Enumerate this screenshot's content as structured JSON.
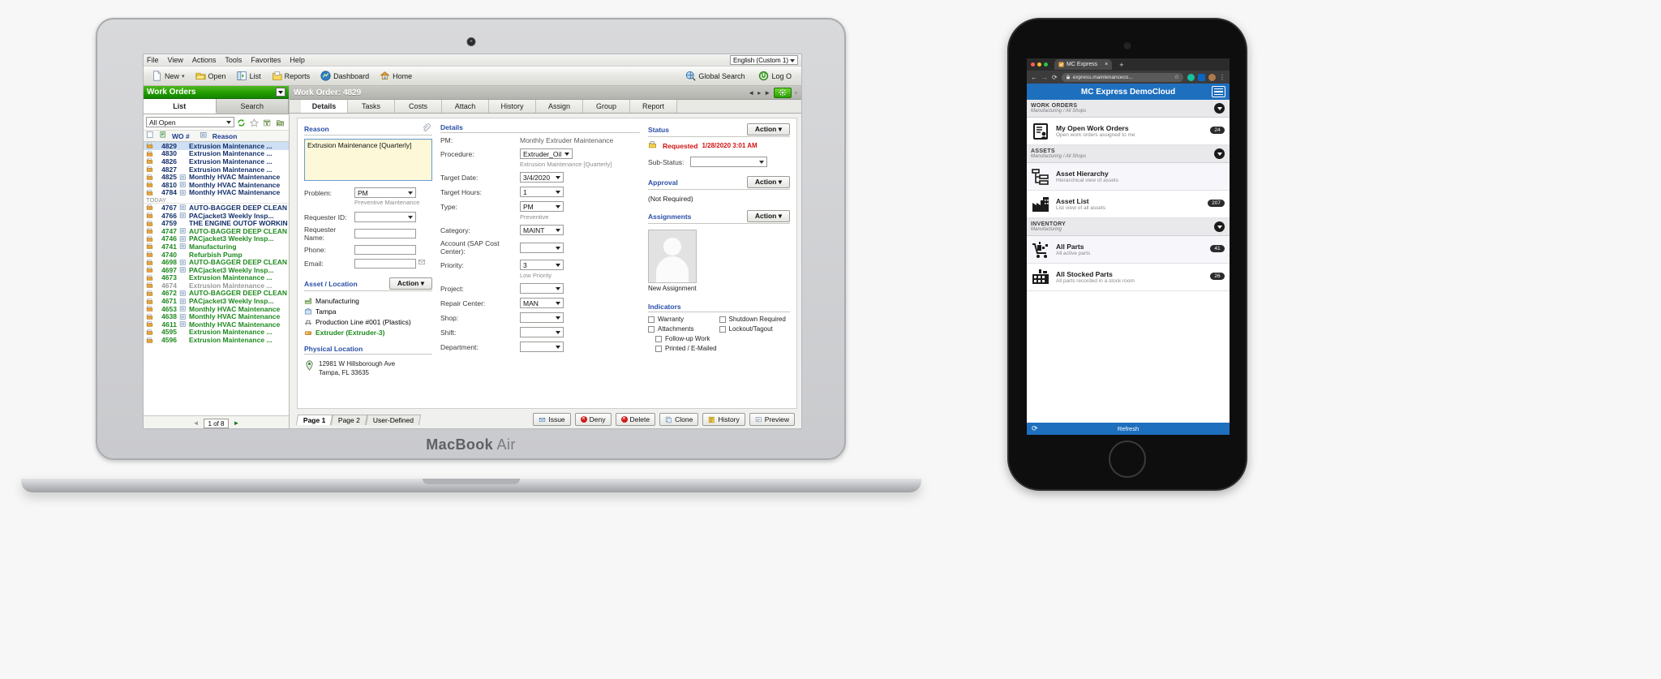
{
  "laptop": {
    "brand_line": "MacBook Air",
    "brand_bold": "MacBook",
    "brand_rest": " Air"
  },
  "app": {
    "menubar": [
      "File",
      "View",
      "Actions",
      "Tools",
      "Favorites",
      "Help"
    ],
    "language": "English (Custom 1)",
    "toolbar": [
      {
        "label": "New",
        "icon": "page-icon",
        "caret": true
      },
      {
        "label": "Open",
        "icon": "open-folder-icon"
      },
      {
        "label": "List",
        "icon": "list-icon"
      },
      {
        "label": "Reports",
        "icon": "reports-icon"
      },
      {
        "label": "Dashboard",
        "icon": "dashboard-icon"
      },
      {
        "label": "Home",
        "icon": "home-icon"
      }
    ],
    "toolbar_right": [
      {
        "label": "Global Search",
        "icon": "globe-search-icon"
      },
      {
        "label": "Log O",
        "icon": "logout-icon"
      }
    ]
  },
  "left": {
    "module_title": "Work Orders",
    "tabs": [
      {
        "label": "List",
        "active": true
      },
      {
        "label": "Search",
        "active": false
      }
    ],
    "filter": "All Open",
    "columns": [
      "WO #",
      "Reason"
    ],
    "today_label": "TODAY",
    "rows": [
      {
        "wo": "4829",
        "reason": "Extrusion Maintenance ...",
        "color": "dark",
        "selected": true,
        "pm": false
      },
      {
        "wo": "4830",
        "reason": "Extrusion Maintenance ...",
        "color": "dark",
        "selected": false,
        "pm": false
      },
      {
        "wo": "4826",
        "reason": "Extrusion Maintenance ...",
        "color": "dark",
        "selected": false,
        "pm": false
      },
      {
        "wo": "4827",
        "reason": "Extrusion Maintenance ...",
        "color": "dark",
        "selected": false,
        "pm": false
      },
      {
        "wo": "4825",
        "reason": "Monthly HVAC Maintenance",
        "color": "dark",
        "selected": false,
        "pm": true
      },
      {
        "wo": "4810",
        "reason": "Monthly HVAC Maintenance",
        "color": "dark",
        "selected": false,
        "pm": true
      },
      {
        "wo": "4784",
        "reason": "Monthly HVAC Maintenance",
        "color": "dark",
        "selected": false,
        "pm": true
      },
      {
        "wo": "4767",
        "reason": "AUTO-BAGGER DEEP CLEAN",
        "color": "dark",
        "selected": false,
        "pm": true
      },
      {
        "wo": "4766",
        "reason": "PACjacket3 Weekly Insp...",
        "color": "dark",
        "selected": false,
        "pm": true
      },
      {
        "wo": "4759",
        "reason": "THE ENGINE OUTOF WORKIN",
        "color": "dark",
        "selected": false,
        "pm": false
      },
      {
        "wo": "4747",
        "reason": "AUTO-BAGGER DEEP CLEAN",
        "color": "green",
        "selected": false,
        "pm": true
      },
      {
        "wo": "4746",
        "reason": "PACjacket3 Weekly Insp...",
        "color": "green",
        "selected": false,
        "pm": true
      },
      {
        "wo": "4741",
        "reason": "Manufacturing",
        "color": "green",
        "selected": false,
        "pm": true
      },
      {
        "wo": "4740",
        "reason": "Refurbish Pump",
        "color": "green",
        "selected": false,
        "pm": false
      },
      {
        "wo": "4698",
        "reason": "AUTO-BAGGER DEEP CLEAN",
        "color": "green",
        "selected": false,
        "pm": true
      },
      {
        "wo": "4697",
        "reason": "PACjacket3 Weekly Insp...",
        "color": "green",
        "selected": false,
        "pm": true
      },
      {
        "wo": "4673",
        "reason": "Extrusion Maintenance ...",
        "color": "green",
        "selected": false,
        "pm": false
      },
      {
        "wo": "4674",
        "reason": "Extrusion Maintenance ...",
        "color": "gray",
        "selected": false,
        "pm": false
      },
      {
        "wo": "4672",
        "reason": "AUTO-BAGGER DEEP CLEAN",
        "color": "green",
        "selected": false,
        "pm": true
      },
      {
        "wo": "4671",
        "reason": "PACjacket3 Weekly Insp...",
        "color": "green",
        "selected": false,
        "pm": true
      },
      {
        "wo": "4653",
        "reason": "Monthly HVAC Maintenance",
        "color": "green",
        "selected": false,
        "pm": true
      },
      {
        "wo": "4638",
        "reason": "Monthly HVAC Maintenance",
        "color": "green",
        "selected": false,
        "pm": true
      },
      {
        "wo": "4611",
        "reason": "Monthly HVAC Maintenance",
        "color": "green",
        "selected": false,
        "pm": true
      },
      {
        "wo": "4595",
        "reason": "Extrusion Maintenance ...",
        "color": "green",
        "selected": false,
        "pm": false
      },
      {
        "wo": "4596",
        "reason": "Extrusion Maintenance ...",
        "color": "green",
        "selected": false,
        "pm": false
      }
    ],
    "pager": {
      "text": "1 of 8",
      "prev": "◄",
      "next": "►"
    }
  },
  "record": {
    "title": "Work Order: 4829",
    "tabs": [
      {
        "label": "Details",
        "active": true
      },
      {
        "label": "Tasks",
        "active": false
      },
      {
        "label": "Costs",
        "active": false
      },
      {
        "label": "Attach",
        "active": false
      },
      {
        "label": "History",
        "active": false
      },
      {
        "label": "Assign",
        "active": false
      },
      {
        "label": "Group",
        "active": false
      },
      {
        "label": "Report",
        "active": false
      }
    ]
  },
  "reason_panel": {
    "label": "Reason",
    "text": "Extrusion Maintenance [Quarterly]",
    "problem_label": "Problem:",
    "problem_value": "PM",
    "problem_hint": "Preventive Maintenance",
    "requester_id_label": "Requester ID:",
    "requester_id_value": "",
    "requester_name_label": "Requester Name:",
    "requester_name_value": "",
    "phone_label": "Phone:",
    "phone_value": "",
    "email_label": "Email:",
    "email_value": ""
  },
  "asset_panel": {
    "label": "Asset / Location",
    "action": "Action",
    "lines": [
      {
        "text": "Manufacturing",
        "icon": "factory-icon",
        "highlight": false
      },
      {
        "text": "Tampa",
        "icon": "site-icon",
        "highlight": false
      },
      {
        "text": "Production Line #001 (Plastics)",
        "icon": "line-icon",
        "highlight": false
      },
      {
        "text": "Extruder (Extruder-3)",
        "icon": "asset-icon",
        "highlight": true
      }
    ],
    "physical_label": "Physical Location",
    "address1": "12981 W Hillsborough Ave",
    "address2": "Tampa, FL 33635"
  },
  "details_panel": {
    "label": "Details",
    "fields": [
      {
        "label": "PM:",
        "type": "text",
        "value": "Monthly Extruder Maintenance"
      },
      {
        "label": "Procedure:",
        "type": "select",
        "value": "Extruder_Oil",
        "hint": "Extrusion Maintenance [Quarterly]"
      },
      {
        "label": "Target Date:",
        "type": "select",
        "value": "3/4/2020"
      },
      {
        "label": "Target Hours:",
        "type": "select",
        "value": "1"
      },
      {
        "label": "Type:",
        "type": "select",
        "value": "PM",
        "hint": "Preventive"
      },
      {
        "label": "Category:",
        "type": "select",
        "value": "MAINT"
      },
      {
        "label": "Account (SAP Cost Center):",
        "type": "select",
        "value": ""
      },
      {
        "label": "Priority:",
        "type": "select",
        "value": "3",
        "hint": "Low Priority"
      },
      {
        "label": "Project:",
        "type": "select",
        "value": ""
      },
      {
        "label": "Repair Center:",
        "type": "select",
        "value": "MAN"
      },
      {
        "label": "Shop:",
        "type": "select",
        "value": ""
      },
      {
        "label": "Shift:",
        "type": "select",
        "value": ""
      },
      {
        "label": "Department:",
        "type": "select",
        "value": ""
      }
    ]
  },
  "status_panel": {
    "label": "Status",
    "action": "Action",
    "state": "Requested",
    "datetime": "1/28/2020 3:01 AM",
    "substatus_label": "Sub-Status:",
    "substatus_value": ""
  },
  "approval_panel": {
    "label": "Approval",
    "action": "Action",
    "value": "(Not Required)"
  },
  "assignments_panel": {
    "label": "Assignments",
    "action": "Action",
    "caption": "New Assignment"
  },
  "indicators_panel": {
    "label": "Indicators",
    "items": [
      {
        "label": "Warranty",
        "checked": false
      },
      {
        "label": "Shutdown Required",
        "checked": false
      },
      {
        "label": "Attachments",
        "checked": false
      },
      {
        "label": "Lockout/Tagout",
        "checked": false
      },
      {
        "label": "Follow-up Work",
        "checked": false
      },
      {
        "label": "Printed / E-Mailed",
        "checked": false
      }
    ]
  },
  "page_tabs": [
    {
      "label": "Page 1",
      "active": true
    },
    {
      "label": "Page 2",
      "active": false
    },
    {
      "label": "User-Defined",
      "active": false
    }
  ],
  "bottom_buttons": [
    {
      "label": "Issue",
      "icon": "issue-icon",
      "style": "plain"
    },
    {
      "label": "Deny",
      "icon": "deny-icon",
      "style": "red"
    },
    {
      "label": "Delete",
      "icon": "delete-icon",
      "style": "red"
    },
    {
      "label": "Clone",
      "icon": "clone-icon",
      "style": "plain"
    },
    {
      "label": "History",
      "icon": "history-icon",
      "style": "plain"
    },
    {
      "label": "Preview",
      "icon": "preview-icon",
      "style": "plain"
    }
  ],
  "phone": {
    "browser": {
      "tab_title": "MC Express",
      "url": "express.maintenanceco...",
      "new_tab": "+",
      "close": "×",
      "back": "←",
      "forward": "→",
      "reload": "⟳"
    },
    "app_title": "MC Express DemoCloud",
    "groups": [
      {
        "title": "WORK ORDERS",
        "subtitle": "Manufacturing / All Shops",
        "items": [
          {
            "title": "My Open Work Orders",
            "sub": "Open work orders assigned to me",
            "badge": "24",
            "icon": "clipboard-person-icon",
            "alt": false
          }
        ]
      },
      {
        "title": "ASSETS",
        "subtitle": "Manufacturing / All Shops",
        "items": [
          {
            "title": "Asset Hierarchy",
            "sub": "Hierarchical view of assets",
            "badge": "",
            "icon": "hierarchy-icon",
            "alt": true
          },
          {
            "title": "Asset List",
            "sub": "List view of all assets",
            "badge": "207",
            "icon": "factory-icon",
            "alt": false
          }
        ]
      },
      {
        "title": "INVENTORY",
        "subtitle": "Manufacturing",
        "items": [
          {
            "title": "All Parts",
            "sub": "All active parts",
            "badge": "41",
            "icon": "cart-parts-icon",
            "alt": true
          },
          {
            "title": "All Stocked Parts",
            "sub": "All parts recorded in a stock room",
            "badge": "26",
            "icon": "stockroom-icon",
            "alt": false
          }
        ]
      }
    ],
    "refresh": "Refresh",
    "refresh_icon": "⟳"
  },
  "colors": {
    "module_green": "#1f9a00",
    "status_red": "#d31212",
    "link_blue": "#2a4fa8",
    "phone_blue": "#1e6fbe",
    "selected_row": "#cfe0f5",
    "reason_yellow": "#fcf8d8"
  }
}
